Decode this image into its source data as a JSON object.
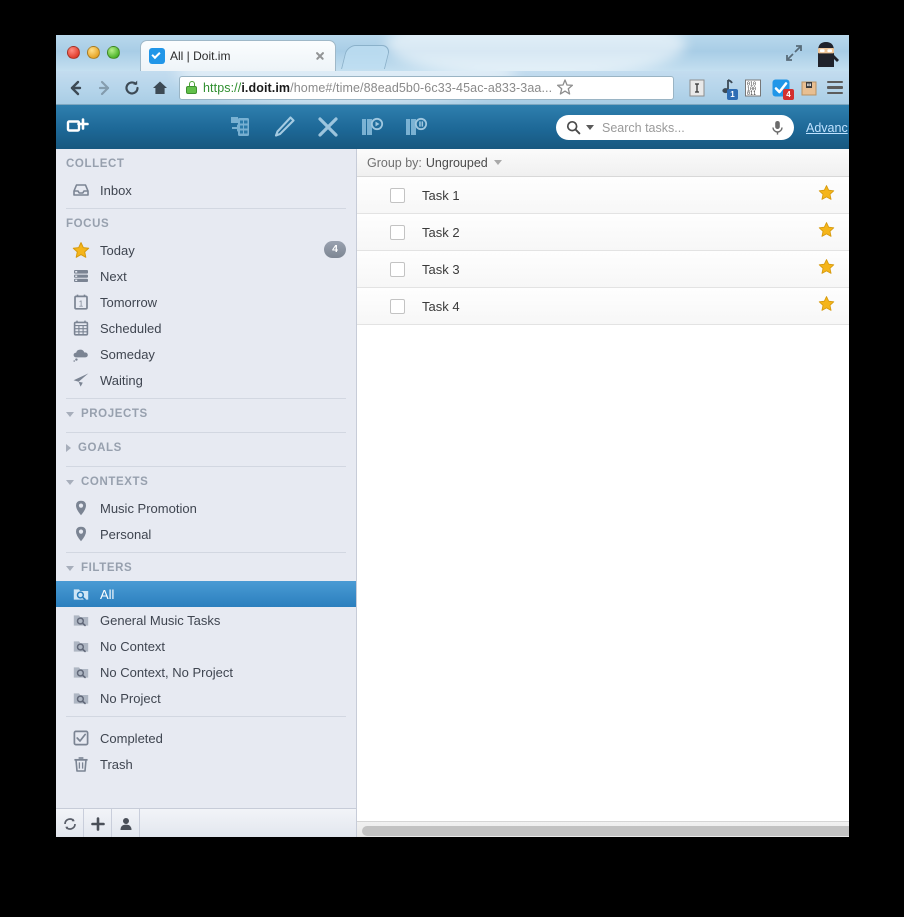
{
  "browser": {
    "tab": {
      "title": "All | Doit.im",
      "favicon": "check-circle-icon",
      "close": "×"
    },
    "window_controls": {
      "close": "close-button",
      "minimize": "minimize-button",
      "zoom": "zoom-button"
    },
    "nav": {
      "back": "back-arrow-icon",
      "forward": "forward-arrow-icon",
      "reload": "reload-icon",
      "home": "home-icon"
    },
    "url": {
      "scheme": "https://",
      "host": "i.doit.im",
      "path": "/home#/time/88ead5b0-6c33-45ac-a833-3aa...",
      "full": "https://i.doit.im/home#/time/88ead5b0-6c33-45ac-a833-3aa...",
      "secure_icon": "lock-icon"
    },
    "bookmark_icon": "star-outline-icon",
    "extensions": [
      {
        "name": "text-cursor-extension-icon",
        "badge": ""
      },
      {
        "name": "music-note-extension-icon",
        "badge": "1",
        "badge_color": "#2e6db4"
      },
      {
        "name": "qr-code-extension-icon",
        "badge": ""
      },
      {
        "name": "doit-checkmark-extension-icon",
        "badge": "4",
        "badge_color": "#d32f2f"
      },
      {
        "name": "package-extension-icon",
        "badge": ""
      }
    ],
    "menu_icon": "hamburger-menu-icon",
    "fullscreen_icon": "expand-arrows-icon",
    "profile_icon": "ninja-avatar-icon"
  },
  "app": {
    "toolbar": {
      "add_task": "add-task-icon",
      "move_to": "move-to-icon",
      "edit": "pencil-icon",
      "delete": "close-x-icon",
      "start_timer": "timer-play-icon",
      "pause_timer": "timer-pause-icon"
    },
    "search": {
      "placeholder": "Search tasks...",
      "value": "",
      "search_icon": "magnifier-icon",
      "dropdown_icon": "chevron-down-icon",
      "mic_icon": "microphone-icon"
    },
    "advanced_link": "Advanc",
    "sidebar": {
      "sections": [
        {
          "label": "COLLECT",
          "caret": "none",
          "items": [
            {
              "label": "Inbox",
              "icon": "inbox-icon",
              "badge": "",
              "selected": false
            }
          ]
        },
        {
          "label": "FOCUS",
          "caret": "none",
          "items": [
            {
              "label": "Today",
              "icon": "star-icon",
              "badge": "4",
              "selected": false
            },
            {
              "label": "Next",
              "icon": "list-icon",
              "badge": "",
              "selected": false
            },
            {
              "label": "Tomorrow",
              "icon": "calendar-day-icon",
              "badge": "",
              "selected": false
            },
            {
              "label": "Scheduled",
              "icon": "calendar-icon",
              "badge": "",
              "selected": false
            },
            {
              "label": "Someday",
              "icon": "cloud-icon",
              "badge": "",
              "selected": false
            },
            {
              "label": "Waiting",
              "icon": "paper-plane-icon",
              "badge": "",
              "selected": false
            }
          ]
        },
        {
          "label": "PROJECTS",
          "caret": "down",
          "items": []
        },
        {
          "label": "GOALS",
          "caret": "right",
          "items": []
        },
        {
          "label": "CONTEXTS",
          "caret": "down",
          "items": [
            {
              "label": "Music Promotion",
              "icon": "location-pin-icon",
              "badge": "",
              "selected": false
            },
            {
              "label": "Personal",
              "icon": "location-pin-icon",
              "badge": "",
              "selected": false
            }
          ]
        },
        {
          "label": "FILTERS",
          "caret": "down",
          "items": [
            {
              "label": "All",
              "icon": "folder-search-icon",
              "badge": "",
              "selected": true
            },
            {
              "label": "General Music Tasks",
              "icon": "folder-search-icon",
              "badge": "",
              "selected": false
            },
            {
              "label": "No Context",
              "icon": "folder-search-icon",
              "badge": "",
              "selected": false
            },
            {
              "label": "No Context, No Project",
              "icon": "folder-search-icon",
              "badge": "",
              "selected": false
            },
            {
              "label": "No Project",
              "icon": "folder-search-icon",
              "badge": "",
              "selected": false
            }
          ]
        },
        {
          "label": "",
          "caret": "none",
          "items": [
            {
              "label": "Completed",
              "icon": "checkbox-checked-icon",
              "badge": "",
              "selected": false
            },
            {
              "label": "Trash",
              "icon": "trash-icon",
              "badge": "",
              "selected": false
            }
          ]
        }
      ],
      "footer": [
        {
          "name": "sync-button",
          "icon": "sync-icon"
        },
        {
          "name": "add-button",
          "icon": "plus-icon"
        },
        {
          "name": "account-button",
          "icon": "person-icon"
        }
      ]
    },
    "content": {
      "group_by_label": "Group by:",
      "group_by_value": "Ungrouped",
      "tasks": [
        {
          "title": "Task 1",
          "checked": false,
          "starred": true
        },
        {
          "title": "Task 2",
          "checked": false,
          "starred": true
        },
        {
          "title": "Task 3",
          "checked": false,
          "starred": true
        },
        {
          "title": "Task 4",
          "checked": false,
          "starred": true
        }
      ]
    }
  },
  "colors": {
    "toolbar_blue": "#1d6897",
    "selected_blue": "#2b7fbe",
    "sidebar_bg": "#e7eaf2",
    "star_gold": "#f5b51a",
    "badge_gray": "#7d8693"
  }
}
